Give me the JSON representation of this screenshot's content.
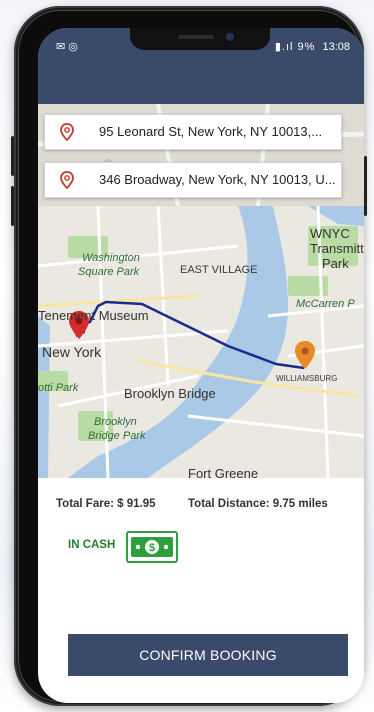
{
  "status_bar": {
    "left_icons": "✉ ◎",
    "signal_battery": "▮.ıl 9%",
    "time": "13:08"
  },
  "locations": {
    "pickup": "95 Leonard St, New York, NY 10013,...",
    "dropoff": "346 Broadway, New York, NY 10013, U..."
  },
  "map": {
    "labels": [
      {
        "text": "WNYC",
        "cls": "big"
      },
      {
        "text": "Transmitt",
        "cls": "big"
      },
      {
        "text": "Park",
        "cls": "big"
      },
      {
        "text": "Washington",
        "cls": "italic"
      },
      {
        "text": "Square Park",
        "cls": "italic"
      },
      {
        "text": "EAST VILLAGE",
        "cls": ""
      },
      {
        "text": "Tenement Museum",
        "cls": "big"
      },
      {
        "text": "McCarren P",
        "cls": "italic"
      },
      {
        "text": "New York",
        "cls": "big"
      },
      {
        "text": "WILLIAMSBURG",
        "cls": ""
      },
      {
        "text": "otti Park",
        "cls": "italic"
      },
      {
        "text": "Brooklyn Bridge",
        "cls": "big"
      },
      {
        "text": "Brooklyn",
        "cls": "italic"
      },
      {
        "text": "Bridge Park",
        "cls": "italic"
      },
      {
        "text": "Fort Greene",
        "cls": "big"
      }
    ],
    "colors": {
      "route": "#1b2a8f",
      "pickup_pin": "#d62b2b",
      "dropoff_pin": "#e8892a",
      "water": "#a9c9e6",
      "land": "#ebe8e1",
      "park": "#b9dba4"
    }
  },
  "fare": {
    "total_fare_label": "Total Fare:",
    "total_fare_value": "$ 91.95",
    "total_distance_label": "Total Distance:",
    "total_distance_value": "9.75 miles"
  },
  "payment": {
    "method_label": "IN CASH",
    "icon": "cash-icon"
  },
  "actions": {
    "confirm_label": "CONFIRM BOOKING"
  }
}
